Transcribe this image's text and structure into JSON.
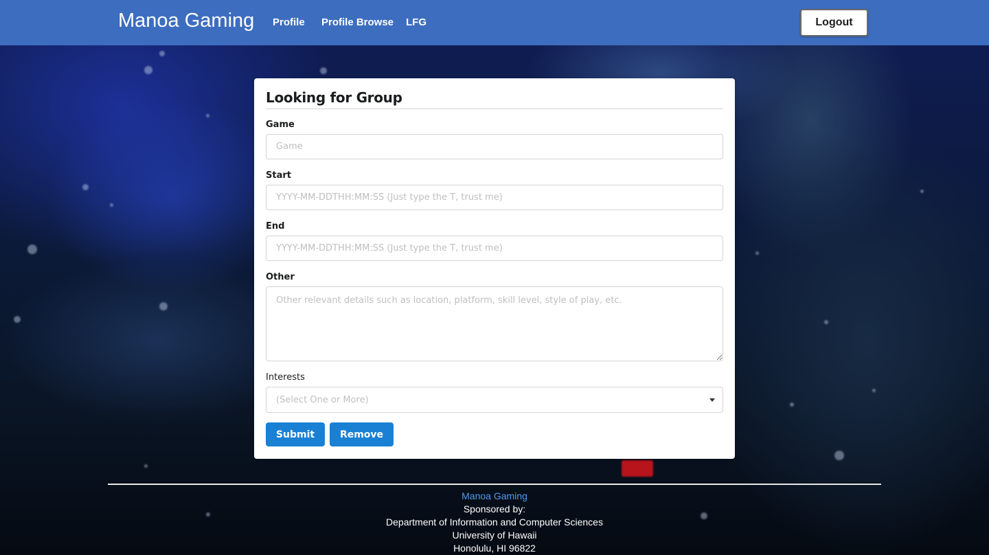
{
  "navbar": {
    "brand": "Manoa Gaming",
    "links": [
      "Profile",
      "Profile Browse",
      "LFG"
    ],
    "logout_label": "Logout"
  },
  "form": {
    "title": "Looking for Group",
    "game": {
      "label": "Game",
      "placeholder": "Game"
    },
    "start": {
      "label": "Start",
      "placeholder": "YYYY-MM-DDTHH:MM:SS (Just type the T, trust me)"
    },
    "end": {
      "label": "End",
      "placeholder": "YYYY-MM-DDTHH:MM:SS (Just type the T, trust me)"
    },
    "other": {
      "label": "Other",
      "placeholder": "Other relevant details such as location, platform, skill level, style of play, etc."
    },
    "interests": {
      "label": "Interests",
      "placeholder": "(Select One or More)"
    },
    "submit_label": "Submit",
    "remove_label": "Remove"
  },
  "footer": {
    "brand": "Manoa Gaming",
    "lines": [
      "Sponsored by:",
      "Department of Information and Computer Sciences",
      "University of Hawaii",
      "Honolulu, HI 96822"
    ]
  },
  "colors": {
    "navbar": "#3d6dbf",
    "button": "#1a80d4",
    "footer_link": "#4e9bf0"
  }
}
